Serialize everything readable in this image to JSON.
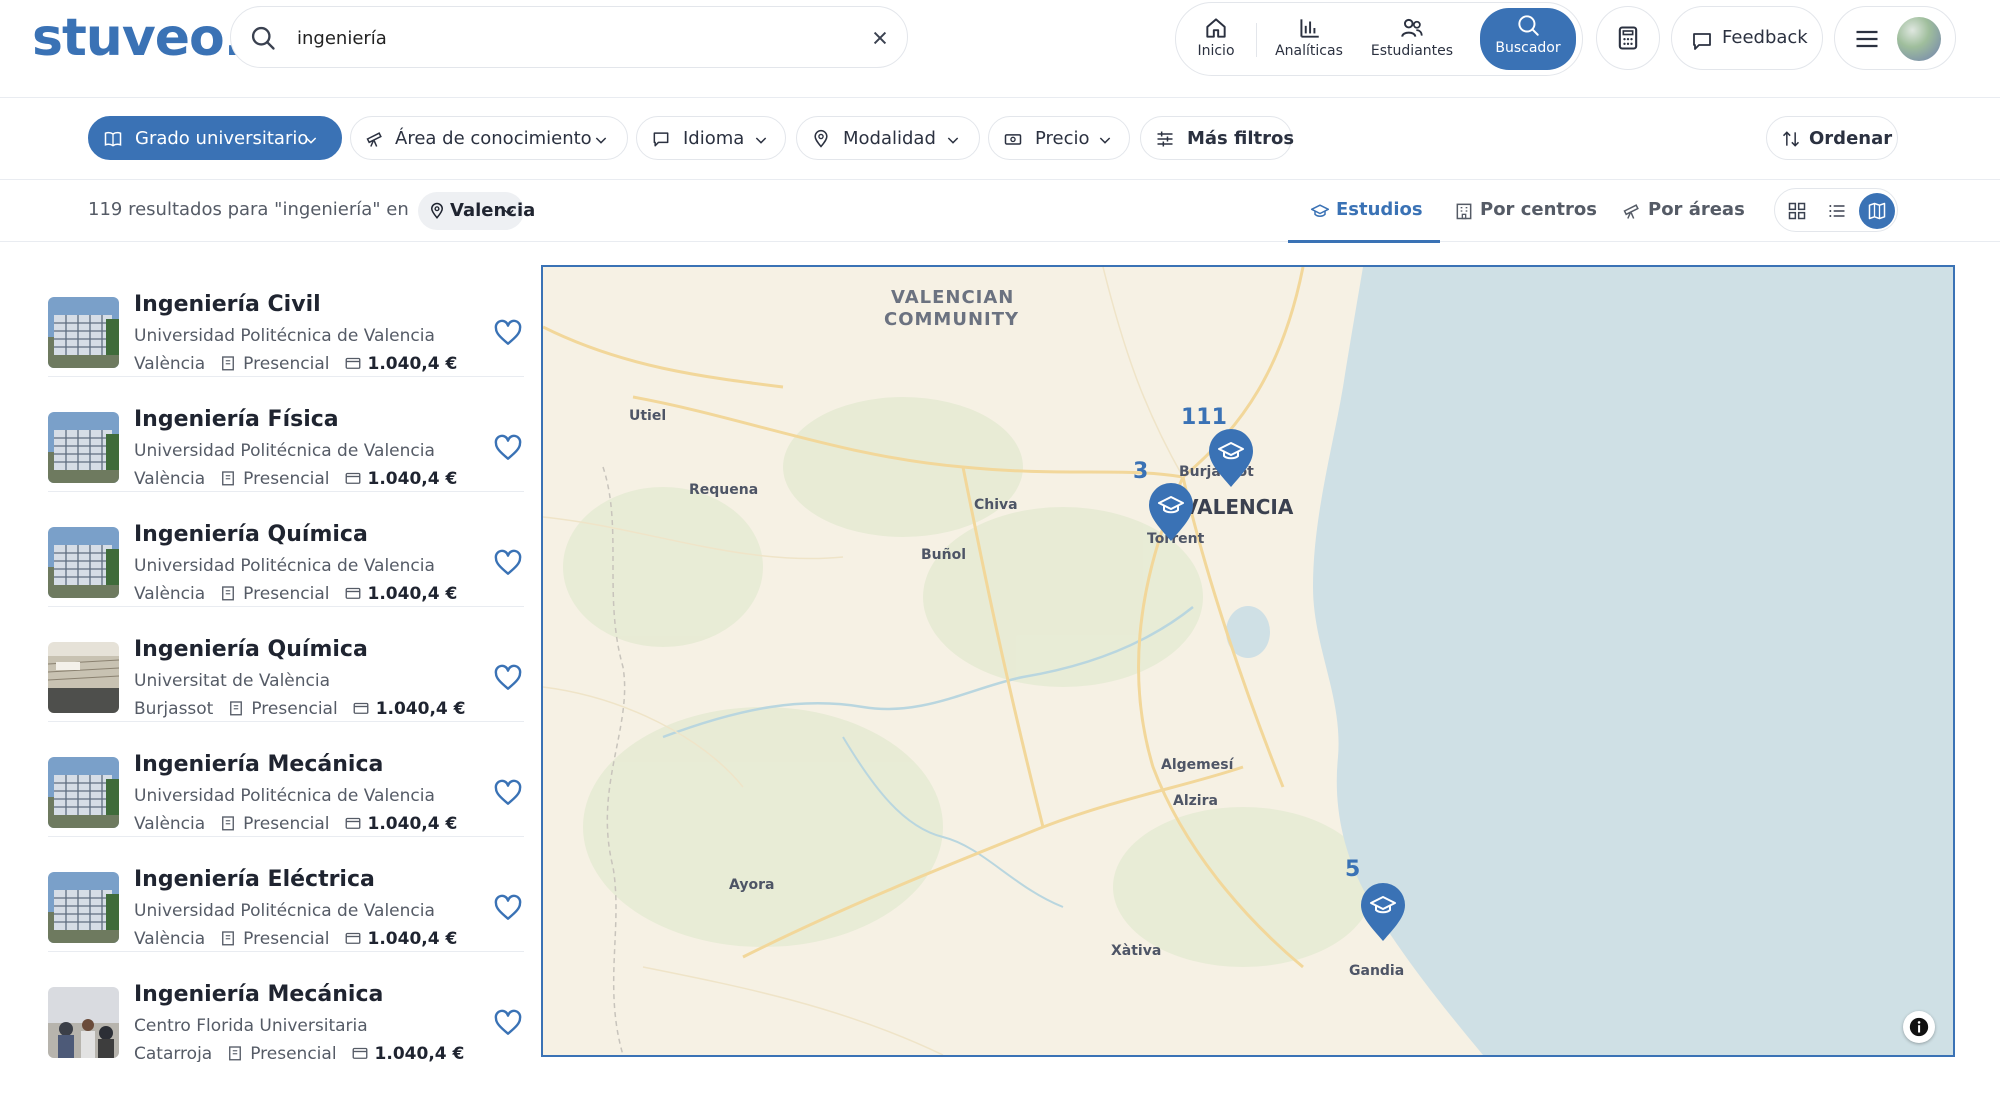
{
  "header": {
    "logo": "stuveo.",
    "search_value": "ingeniería",
    "nav": [
      {
        "label": "Inicio",
        "icon": "home-icon"
      },
      {
        "label": "Analíticas",
        "icon": "bar-chart-icon"
      },
      {
        "label": "Estudiantes",
        "icon": "users-icon"
      },
      {
        "label": "Buscador",
        "icon": "search-icon",
        "active": true
      }
    ],
    "feedback_label": "Feedback"
  },
  "filters": [
    {
      "label": "Grado universitario",
      "icon": "book-icon",
      "primary": true
    },
    {
      "label": "Área de conocimiento",
      "icon": "telescope-icon"
    },
    {
      "label": "Idioma",
      "icon": "chat-icon"
    },
    {
      "label": "Modalidad",
      "icon": "location-pin-icon"
    },
    {
      "label": "Precio",
      "icon": "money-icon"
    },
    {
      "label": "Más filtros",
      "icon": "sliders-icon"
    }
  ],
  "sort_label": "Ordenar",
  "results": {
    "summary": "119 resultados para \"ingeniería\" en",
    "location": "Valencia",
    "tabs": [
      {
        "label": "Estudios",
        "active": true
      },
      {
        "label": "Por centros"
      },
      {
        "label": "Por áreas"
      }
    ]
  },
  "cards": [
    {
      "title": "Ingeniería Civil",
      "uni": "Universidad Politécnica de Valencia",
      "city": "València",
      "mode": "Presencial",
      "price": "1.040,4 €",
      "thumb": "building"
    },
    {
      "title": "Ingeniería Física",
      "uni": "Universidad Politécnica de Valencia",
      "city": "València",
      "mode": "Presencial",
      "price": "1.040,4 €",
      "thumb": "building"
    },
    {
      "title": "Ingeniería Química",
      "uni": "Universidad Politécnica de Valencia",
      "city": "València",
      "mode": "Presencial",
      "price": "1.040,4 €",
      "thumb": "building"
    },
    {
      "title": "Ingeniería Química",
      "uni": "Universitat de València",
      "city": "Burjassot",
      "mode": "Presencial",
      "price": "1.040,4 €",
      "thumb": "facade"
    },
    {
      "title": "Ingeniería Mecánica",
      "uni": "Universidad Politécnica de Valencia",
      "city": "València",
      "mode": "Presencial",
      "price": "1.040,4 €",
      "thumb": "building"
    },
    {
      "title": "Ingeniería Eléctrica",
      "uni": "Universidad Politécnica de Valencia",
      "city": "València",
      "mode": "Presencial",
      "price": "1.040,4 €",
      "thumb": "building"
    },
    {
      "title": "Ingeniería Mecánica",
      "uni": "Centro Florida Universitaria",
      "city": "Catarroja",
      "mode": "Presencial",
      "price": "1.040,4 €",
      "thumb": "people"
    }
  ],
  "map": {
    "region_label_1": "VALENCIAN",
    "region_label_2": "COMMUNITY",
    "places": [
      "Utiel",
      "Requena",
      "Chiva",
      "Buñol",
      "Burjassot",
      "VALENCIA",
      "Torrent",
      "Algemesí",
      "Alzira",
      "Ayora",
      "Xàtiva",
      "Gandia"
    ],
    "clusters": [
      "111",
      "3",
      "5"
    ],
    "colors": {
      "sea": "#cfe0e5",
      "land": "#f6f1e4",
      "road": "#f2d79a",
      "accent": "#3a72b5"
    }
  }
}
